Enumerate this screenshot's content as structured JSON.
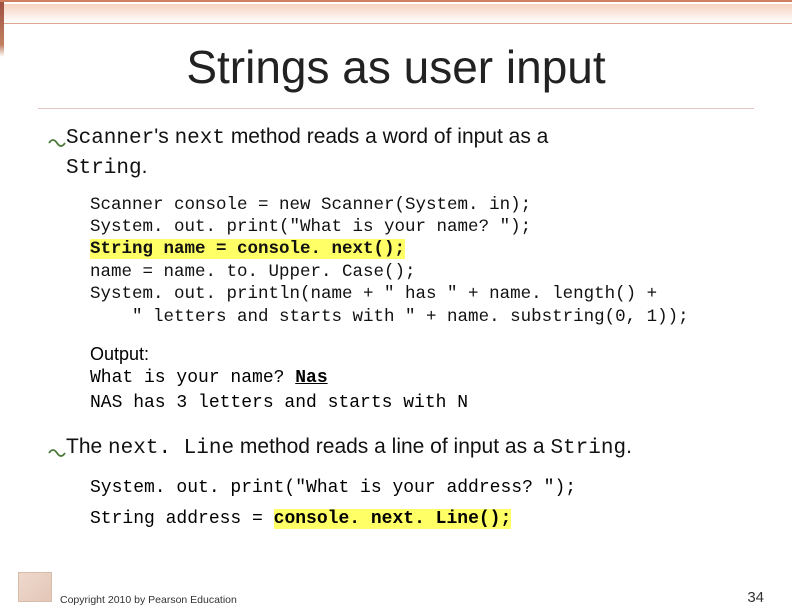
{
  "title": "Strings as user input",
  "bullet1": {
    "code_pre": "Scanner",
    "text_mid1": "'s ",
    "code_mid": "next",
    "text_mid2": " method reads a word of input as a ",
    "code_post": "String",
    "text_post": "."
  },
  "code1": {
    "l1": "Scanner console = new Scanner(System. in);",
    "l2": "System. out. print(\"What is your name? \");",
    "l3": "String name = console. next();",
    "l4": "name = name. to. Upper. Case();",
    "l5": "System. out. println(name + \" has \" + name. length() +",
    "l6": "    \" letters and starts with \" + name. substring(0, 1));"
  },
  "output": {
    "label": "Output:",
    "l1_a": "What is your name? ",
    "l1_b": "Nas",
    "l2": "NAS has 3 letters and starts with N"
  },
  "bullet2": {
    "text_pre": "The ",
    "code_mid": "next. Line",
    "text_mid": " method reads a line of input as a ",
    "code_post": "String",
    "text_post": "."
  },
  "code2": {
    "l1": "System. out. print(\"What is your address? \");",
    "l2_a": "String address = ",
    "l2_b": "console. next. Line();"
  },
  "footer": {
    "copyright": "Copyright 2010 by Pearson Education",
    "pagenum": "34"
  }
}
